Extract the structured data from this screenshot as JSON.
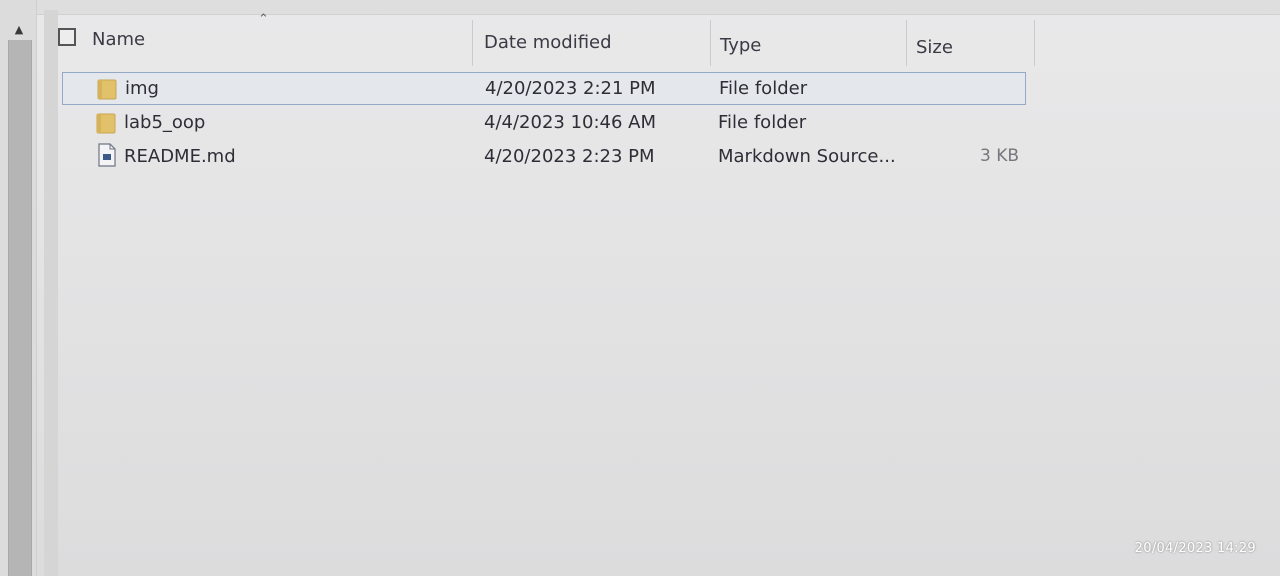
{
  "columns": {
    "name": "Name",
    "date_modified": "Date modified",
    "type": "Type",
    "size": "Size"
  },
  "icons": {
    "folder": "folder-icon",
    "file": "markdown-file-icon",
    "sort": "sort-ascending-arrow-icon",
    "scroll_up": "scroll-up-arrow-icon",
    "folder_color": "#e2c16b",
    "selection_border": "#93a9c6"
  },
  "files": [
    {
      "name": "img",
      "date": "4/20/2023 2:21 PM",
      "type": "File folder",
      "size": "",
      "kind": "folder",
      "selected": true
    },
    {
      "name": "lab5_oop",
      "date": "4/4/2023 10:46 AM",
      "type": "File folder",
      "size": "",
      "kind": "folder",
      "selected": false
    },
    {
      "name": "README.md",
      "date": "4/20/2023 2:23 PM",
      "type": "Markdown Source...",
      "size": "3 KB",
      "kind": "file",
      "selected": false
    }
  ],
  "photo_timestamp": "20/04/2023 14:29"
}
